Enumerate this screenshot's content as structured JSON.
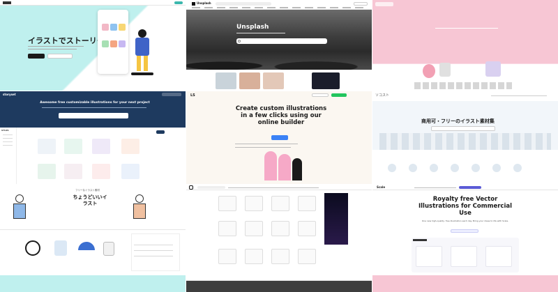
{
  "tile1": {
    "hero_title": "イラストでストーリーを語る",
    "cta_label": "ダウンロード",
    "brand_color": "#1a1a1a",
    "accent": "#f5a623"
  },
  "tile2": {
    "brand": "Unsplash",
    "hero_title": "Unsplash",
    "search_placeholder": "Search free high-resolution photos",
    "cta_label": "Submit a photo"
  },
  "tile4": {
    "brand": "storyset",
    "hero_title": "Awesome free customizable illustrations for your next project",
    "search_placeholder": "Search illustrations",
    "filters_label": "STYLES",
    "accent": "#1fbf8f"
  },
  "tile5": {
    "brand": "LS",
    "hero_title": "Create custom illustrations in a few clicks using our online builder",
    "cta_label": "Get started",
    "accent": "#3b82f6"
  },
  "tile6": {
    "brand": "ソコスト",
    "hero_title": "商用可・フリーのイラスト素材集",
    "accent": "#2b9bd8"
  },
  "tile7": {
    "hero_title": "ちょうどいいイラスト",
    "sub_label": "フリーなイラスト素材"
  },
  "tile9": {
    "brand": "Scale",
    "hero_title": "Royalty free Vector Illustrations for Commercial Use",
    "hero_sub": "One new high-quality, free illustration each day. Bring your ideas to life with Scale.",
    "cta_label": "Choose a color",
    "accent": "#5b5bd6"
  }
}
